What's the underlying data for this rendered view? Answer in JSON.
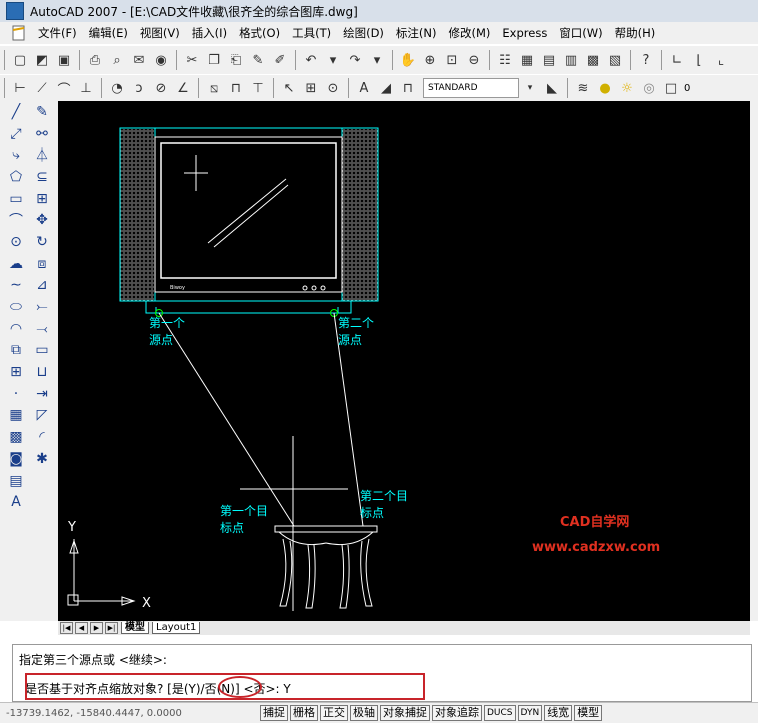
{
  "window": {
    "title": "AutoCAD 2007 - [E:\\CAD文件收藏\\很齐全的综合图库.dwg]"
  },
  "menu": [
    "文件(F)",
    "编辑(E)",
    "视图(V)",
    "插入(I)",
    "格式(O)",
    "工具(T)",
    "绘图(D)",
    "标注(N)",
    "修改(M)",
    "Express",
    "窗口(W)",
    "帮助(H)"
  ],
  "toolbar": {
    "style_combo": "STANDARD",
    "layer_value": "0"
  },
  "canvas": {
    "labels": {
      "src1": "第一个",
      "src1b": "源点",
      "src2": "第二个",
      "src2b": "源点",
      "tgt1": "第一个目",
      "tgt1b": "标点",
      "tgt2": "第二个目",
      "tgt2b": "标点",
      "axis_y": "Y",
      "axis_x": "X",
      "tv_brand": "Biwoy"
    },
    "watermark": {
      "line1": "CAD自学网",
      "line2": "www.cadzxw.com"
    },
    "accent": "#0ff",
    "brand_red": "#e03020"
  },
  "tabs": [
    "模型",
    "Layout1"
  ],
  "command": {
    "line1": "指定第三个源点或 <继续>:",
    "line2": "是否基于对齐点缩放对象? [是(Y)/否(N)] <否>: Y"
  },
  "status": {
    "coords": "-13739.1462, -15840.4447, 0.0000",
    "buttons": [
      "捕捉",
      "栅格",
      "正交",
      "极轴",
      "对象捕捉",
      "对象追踪",
      "DUCS",
      "DYN",
      "线宽",
      "模型"
    ]
  }
}
